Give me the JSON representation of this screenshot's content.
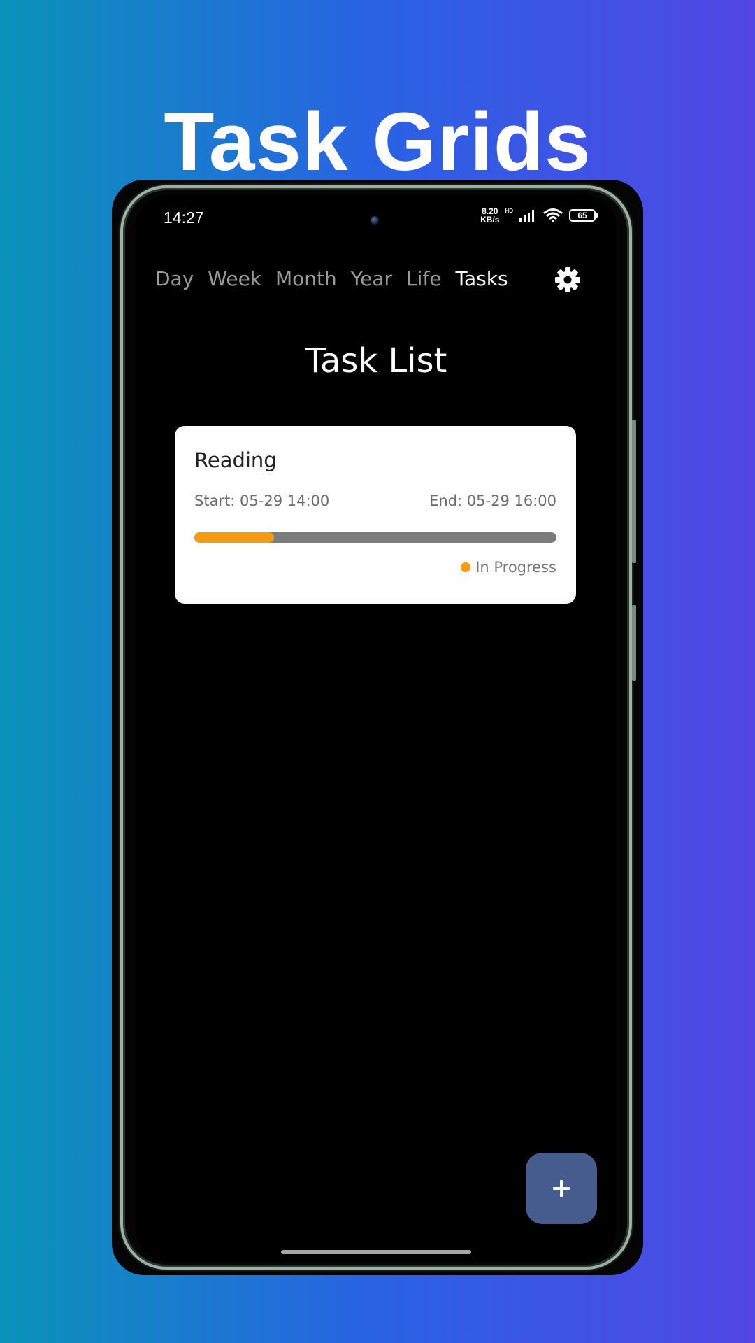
{
  "promo": {
    "headline": "Task Grids"
  },
  "status_bar": {
    "time": "14:27",
    "net_speed_value": "8.20",
    "net_speed_unit": "KB/s",
    "network_type": "HD",
    "battery": "65",
    "icons": [
      "signal-icon",
      "wifi-icon",
      "battery-icon"
    ]
  },
  "nav": {
    "tabs": [
      {
        "label": "Day",
        "active": false
      },
      {
        "label": "Week",
        "active": false
      },
      {
        "label": "Month",
        "active": false
      },
      {
        "label": "Year",
        "active": false
      },
      {
        "label": "Life",
        "active": false
      },
      {
        "label": "Tasks",
        "active": true
      }
    ],
    "settings_icon": "gear-icon"
  },
  "page": {
    "title": "Task List"
  },
  "tasks": [
    {
      "name": "Reading",
      "start": "Start: 05-29 14:00",
      "end": "End: 05-29 16:00",
      "progress": 0.22,
      "status": "In Progress",
      "status_color": "#f39c12"
    }
  ],
  "fab": {
    "icon": "plus-icon"
  },
  "colors": {
    "accent": "#f39c12",
    "progress_track": "#7c7c7c",
    "fab": "#465b8e",
    "screen_bg": "#000000"
  }
}
